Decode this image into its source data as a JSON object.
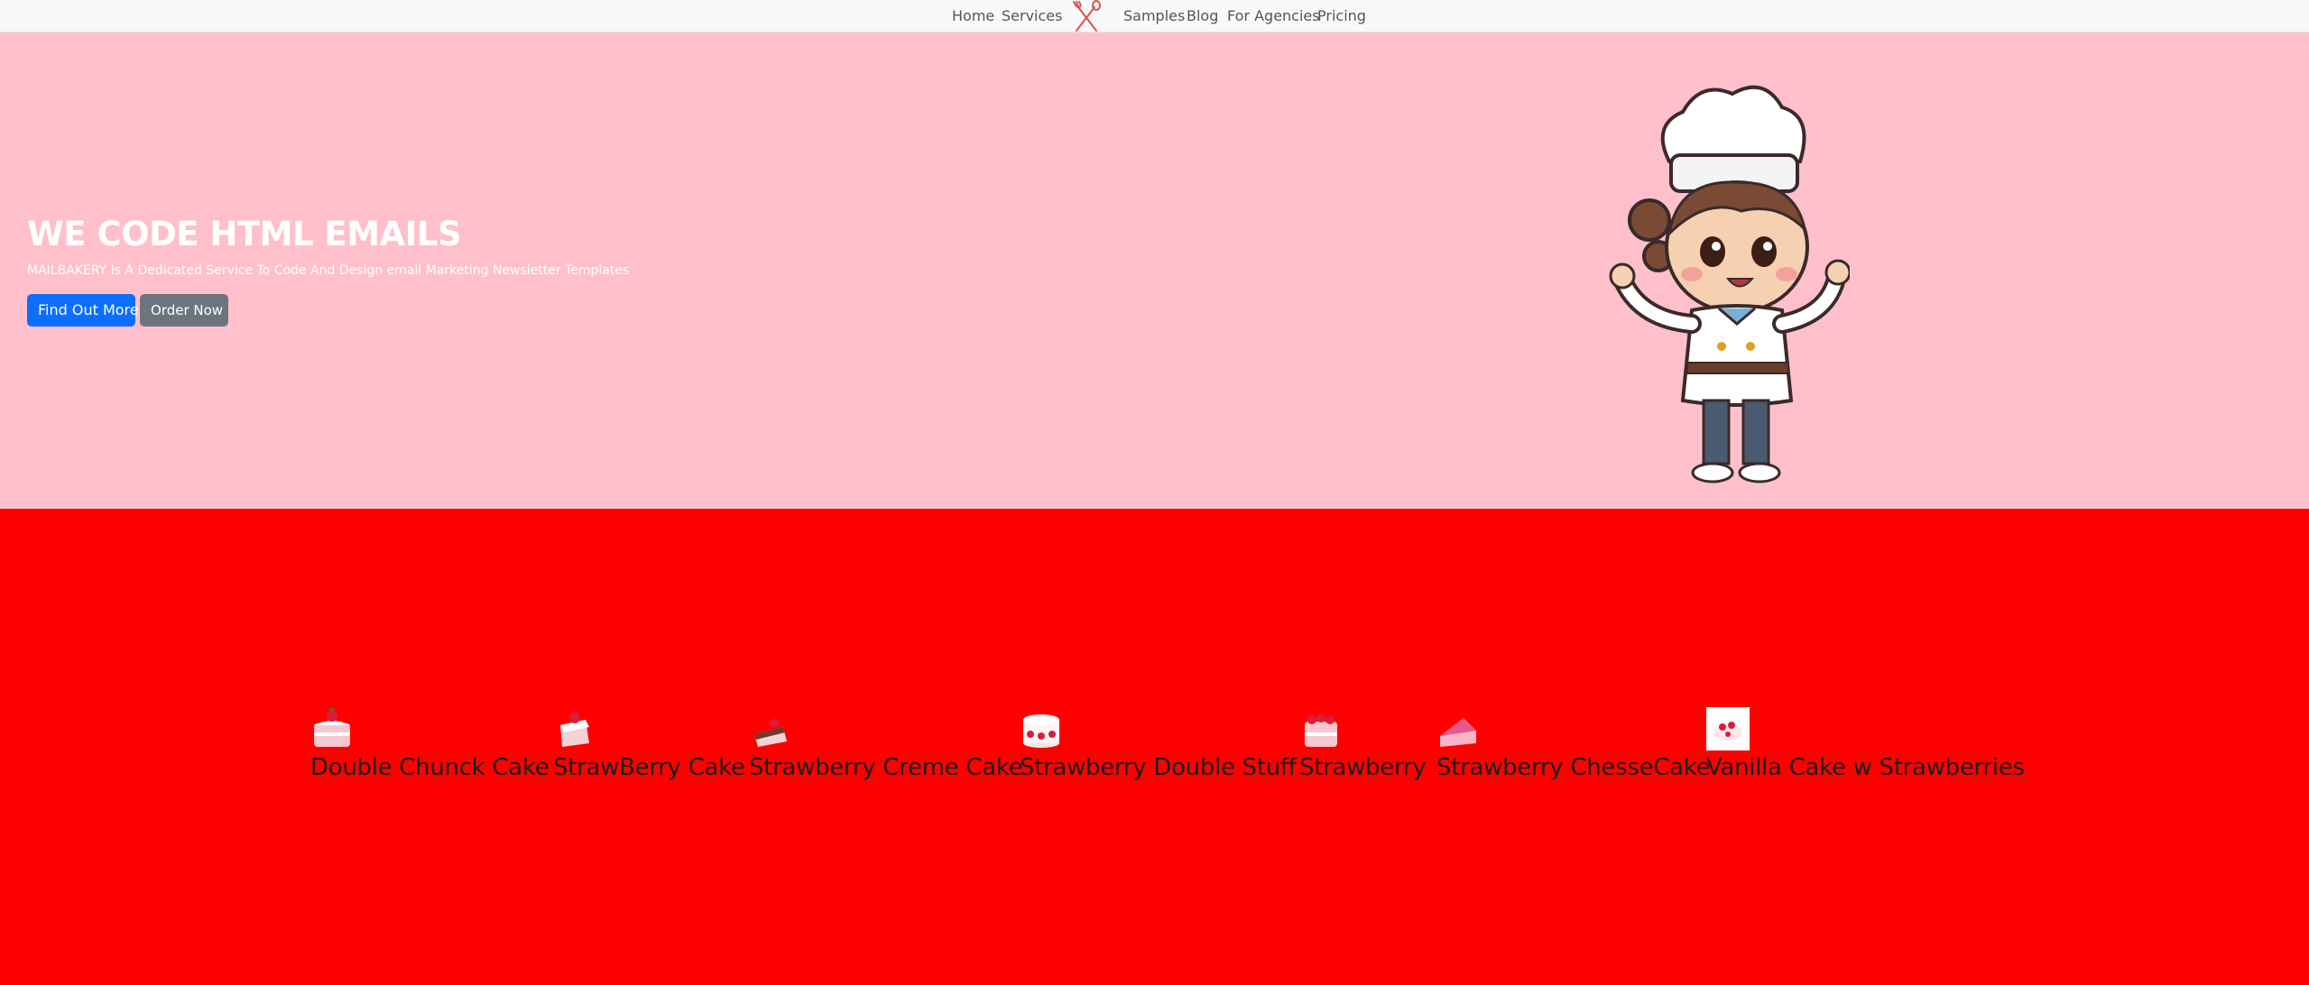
{
  "nav": {
    "left_links": [
      "Home",
      "Services"
    ],
    "logo_icon": "crossed-spoon-whisk-icon",
    "right_links": [
      "Samples",
      "Blog",
      "For Agencies",
      "Pricing"
    ]
  },
  "hero": {
    "title": "WE CODE HTML EMAILS",
    "subtitle": "MAILBAKERY Is A Dedicated Service To Code And Design email Marketing Newsletter Templates",
    "primary_button": "Find Out More",
    "secondary_button": "Order Now",
    "image": "chef-girl-illustration",
    "background": "#ffc0cb"
  },
  "cakes": {
    "background": "#ff0000",
    "items": [
      {
        "name": "Double Chunck Cake",
        "icon": "layer-cake-icon"
      },
      {
        "name": "StrawBerry Cake",
        "icon": "cake-slice-icon"
      },
      {
        "name": "Strawberry Creme Cake",
        "icon": "cake-slice-icon"
      },
      {
        "name": "Strawberry Double Stuff",
        "icon": "round-cake-icon"
      },
      {
        "name": "Strawberry",
        "icon": "strawberry-cake-icon"
      },
      {
        "name": "Strawberry ChesseCake",
        "icon": "cheesecake-slice-icon"
      },
      {
        "name": "Vanilla Cake w Strawberries",
        "icon": "cake-icon"
      }
    ]
  },
  "colors": {
    "primary": "#0d6efd",
    "secondary": "#6c757d",
    "navbar": "#f8f9fa"
  }
}
